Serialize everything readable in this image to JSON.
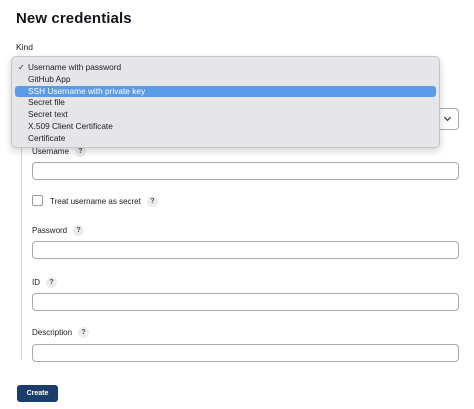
{
  "page": {
    "title": "New credentials",
    "kind_label": "Kind"
  },
  "kind_menu": {
    "selected": "Username with password",
    "highlighted": "SSH Username with private key",
    "options": [
      "Username with password",
      "GitHub App",
      "SSH Username with private key",
      "Secret file",
      "Secret text",
      "X.509 Client Certificate",
      "Certificate"
    ]
  },
  "form": {
    "username_label": "Username",
    "username_value": "",
    "treat_secret_label": "Treat username as secret",
    "treat_secret_checked": false,
    "password_label": "Password",
    "password_value": "",
    "id_label": "ID",
    "id_value": "",
    "description_label": "Description",
    "description_value": "",
    "help_glyph": "?"
  },
  "actions": {
    "create_label": "Create"
  },
  "colors": {
    "menu_highlight": "#5b9ae6",
    "create_button": "#1b3d6b"
  }
}
